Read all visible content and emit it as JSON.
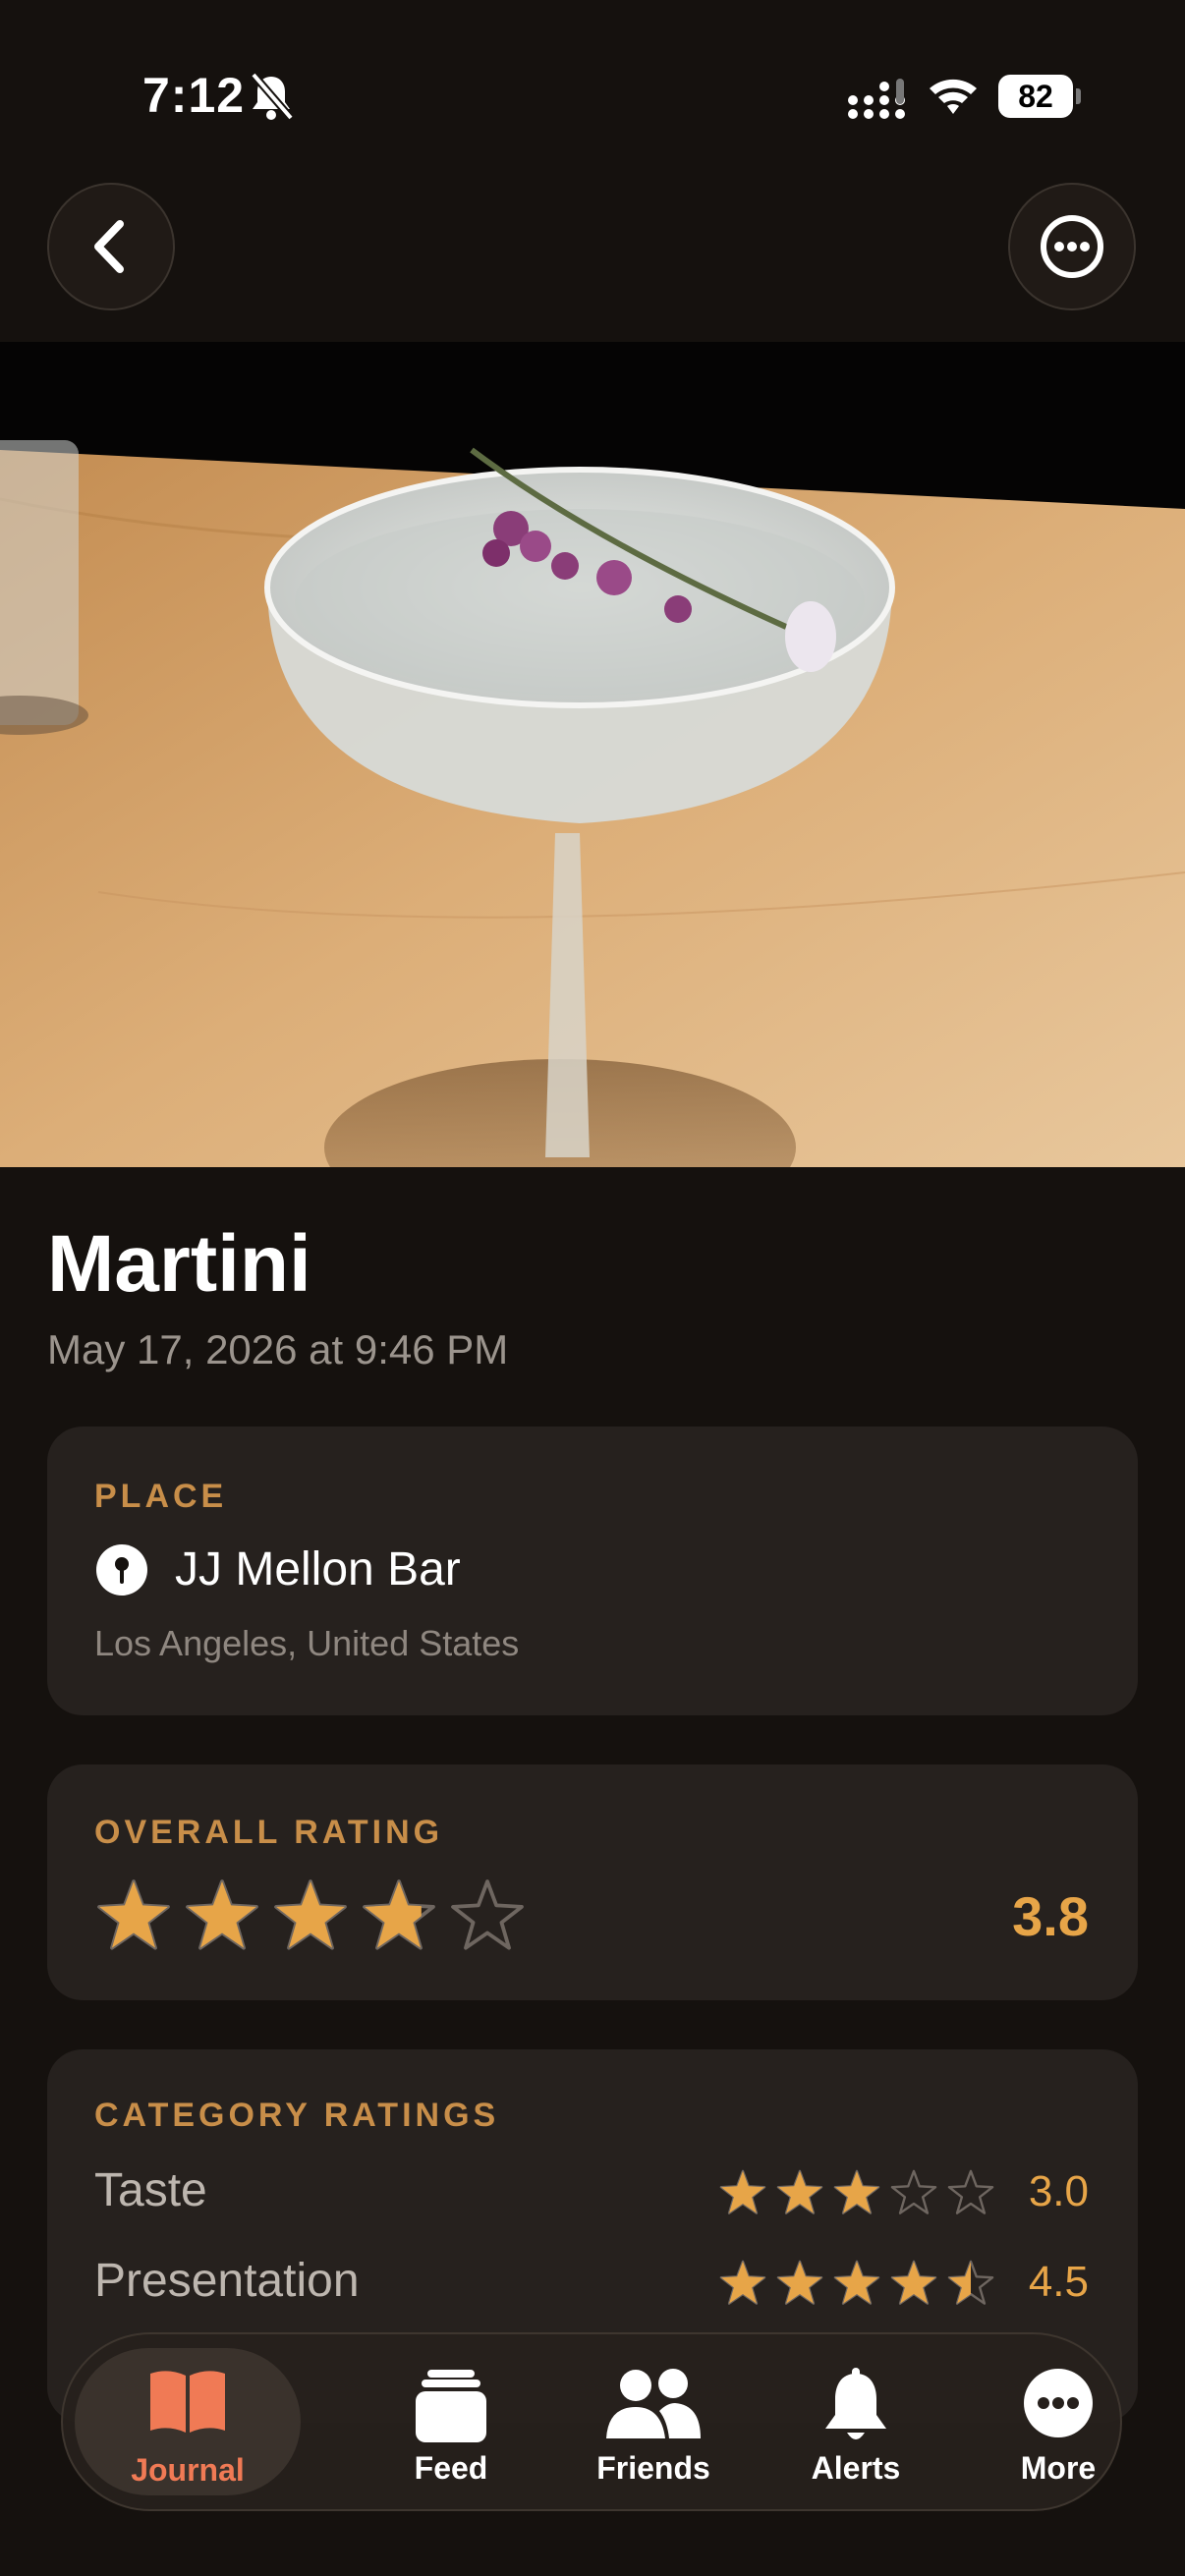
{
  "status_bar": {
    "time": "7:12",
    "battery": "82"
  },
  "entry": {
    "title": "Martini",
    "date": "May 17, 2026 at 9:46 PM"
  },
  "place": {
    "label": "PLACE",
    "name": "JJ Mellon Bar",
    "location": "Los Angeles, United States"
  },
  "overall": {
    "label": "OVERALL RATING",
    "value": "3.8",
    "stars": 3.8
  },
  "categories": {
    "label": "CATEGORY RATINGS",
    "items": [
      {
        "name": "Taste",
        "value": "3.0",
        "stars": 3.0
      },
      {
        "name": "Presentation",
        "value": "4.5",
        "stars": 4.5
      }
    ]
  },
  "tabs": [
    {
      "label": "Journal",
      "icon": "book-icon",
      "active": true
    },
    {
      "label": "Feed",
      "icon": "feed-stack-icon",
      "active": false
    },
    {
      "label": "Friends",
      "icon": "people-icon",
      "active": false
    },
    {
      "label": "Alerts",
      "icon": "bell-icon",
      "active": false
    },
    {
      "label": "More",
      "icon": "more-icon",
      "active": false
    }
  ],
  "colors": {
    "accent": "#e7a548",
    "label": "#c88e49",
    "active_tab": "#f07a55",
    "background": "#15110e",
    "card": "#26211e"
  }
}
